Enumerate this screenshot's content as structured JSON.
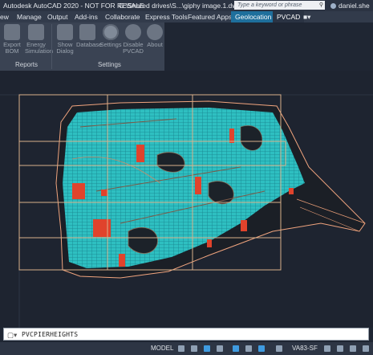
{
  "titlebar": {
    "app_title": "Autodesk AutoCAD 2020 - NOT FOR RESALE",
    "file_path": "G:\\Shared drives\\S...\\giphy image.1.dwg",
    "search_placeholder": "Type a keyword or phrase",
    "user": "daniel.she"
  },
  "menubar": {
    "tabs": [
      "ew",
      "Manage",
      "Output",
      "Add-ins",
      "Collaborate",
      "Express Tools",
      "Featured Apps",
      "Geolocation",
      "PVCAD"
    ],
    "active_tab": "Geolocation",
    "dropdown_icon": "video-camera-icon"
  },
  "ribbon": {
    "reports_panel": {
      "label": "Reports",
      "buttons": [
        {
          "label": "Export BOM",
          "icon": "export-bom-icon"
        },
        {
          "label": "Energy Simulation",
          "icon": "energy-grid-icon"
        }
      ]
    },
    "settings_panel": {
      "label": "Settings",
      "buttons": [
        {
          "label": "Show Dialog",
          "icon": "dialog-icon"
        },
        {
          "label": "Database",
          "icon": "database-icon"
        },
        {
          "label": "Settings",
          "icon": "gear-icon"
        },
        {
          "label": "Disable PVCAD",
          "icon": "power-icon"
        },
        {
          "label": "About",
          "icon": "question-icon"
        }
      ]
    }
  },
  "command_line": {
    "prompt_icon": "terminal-icon",
    "text": "PVCPIERHEIGHTS"
  },
  "statusbar": {
    "model_label": "MODEL",
    "scale_label": "VA83-SF",
    "icons": [
      "grid-icon",
      "snap-icon",
      "ortho-icon",
      "polar-icon",
      "osnap-icon",
      "annotation-icon",
      "workspace-icon",
      "location-icon"
    ]
  },
  "colors": {
    "panel_fill": "#29c6c9",
    "panel_grid": "#1b8f99",
    "red_blocks": "#e0432c",
    "boundary": "#f2b08a",
    "grid_frame": "#d8b08a"
  }
}
